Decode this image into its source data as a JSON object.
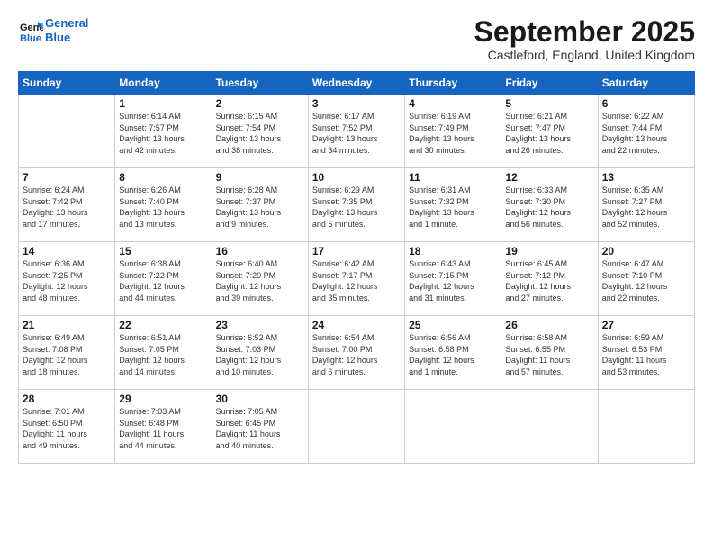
{
  "header": {
    "logo_line1": "General",
    "logo_line2": "Blue",
    "month": "September 2025",
    "location": "Castleford, England, United Kingdom"
  },
  "days_of_week": [
    "Sunday",
    "Monday",
    "Tuesday",
    "Wednesday",
    "Thursday",
    "Friday",
    "Saturday"
  ],
  "weeks": [
    [
      {
        "day": "",
        "info": ""
      },
      {
        "day": "1",
        "info": "Sunrise: 6:14 AM\nSunset: 7:57 PM\nDaylight: 13 hours\nand 42 minutes."
      },
      {
        "day": "2",
        "info": "Sunrise: 6:15 AM\nSunset: 7:54 PM\nDaylight: 13 hours\nand 38 minutes."
      },
      {
        "day": "3",
        "info": "Sunrise: 6:17 AM\nSunset: 7:52 PM\nDaylight: 13 hours\nand 34 minutes."
      },
      {
        "day": "4",
        "info": "Sunrise: 6:19 AM\nSunset: 7:49 PM\nDaylight: 13 hours\nand 30 minutes."
      },
      {
        "day": "5",
        "info": "Sunrise: 6:21 AM\nSunset: 7:47 PM\nDaylight: 13 hours\nand 26 minutes."
      },
      {
        "day": "6",
        "info": "Sunrise: 6:22 AM\nSunset: 7:44 PM\nDaylight: 13 hours\nand 22 minutes."
      }
    ],
    [
      {
        "day": "7",
        "info": "Sunrise: 6:24 AM\nSunset: 7:42 PM\nDaylight: 13 hours\nand 17 minutes."
      },
      {
        "day": "8",
        "info": "Sunrise: 6:26 AM\nSunset: 7:40 PM\nDaylight: 13 hours\nand 13 minutes."
      },
      {
        "day": "9",
        "info": "Sunrise: 6:28 AM\nSunset: 7:37 PM\nDaylight: 13 hours\nand 9 minutes."
      },
      {
        "day": "10",
        "info": "Sunrise: 6:29 AM\nSunset: 7:35 PM\nDaylight: 13 hours\nand 5 minutes."
      },
      {
        "day": "11",
        "info": "Sunrise: 6:31 AM\nSunset: 7:32 PM\nDaylight: 13 hours\nand 1 minute."
      },
      {
        "day": "12",
        "info": "Sunrise: 6:33 AM\nSunset: 7:30 PM\nDaylight: 12 hours\nand 56 minutes."
      },
      {
        "day": "13",
        "info": "Sunrise: 6:35 AM\nSunset: 7:27 PM\nDaylight: 12 hours\nand 52 minutes."
      }
    ],
    [
      {
        "day": "14",
        "info": "Sunrise: 6:36 AM\nSunset: 7:25 PM\nDaylight: 12 hours\nand 48 minutes."
      },
      {
        "day": "15",
        "info": "Sunrise: 6:38 AM\nSunset: 7:22 PM\nDaylight: 12 hours\nand 44 minutes."
      },
      {
        "day": "16",
        "info": "Sunrise: 6:40 AM\nSunset: 7:20 PM\nDaylight: 12 hours\nand 39 minutes."
      },
      {
        "day": "17",
        "info": "Sunrise: 6:42 AM\nSunset: 7:17 PM\nDaylight: 12 hours\nand 35 minutes."
      },
      {
        "day": "18",
        "info": "Sunrise: 6:43 AM\nSunset: 7:15 PM\nDaylight: 12 hours\nand 31 minutes."
      },
      {
        "day": "19",
        "info": "Sunrise: 6:45 AM\nSunset: 7:12 PM\nDaylight: 12 hours\nand 27 minutes."
      },
      {
        "day": "20",
        "info": "Sunrise: 6:47 AM\nSunset: 7:10 PM\nDaylight: 12 hours\nand 22 minutes."
      }
    ],
    [
      {
        "day": "21",
        "info": "Sunrise: 6:49 AM\nSunset: 7:08 PM\nDaylight: 12 hours\nand 18 minutes."
      },
      {
        "day": "22",
        "info": "Sunrise: 6:51 AM\nSunset: 7:05 PM\nDaylight: 12 hours\nand 14 minutes."
      },
      {
        "day": "23",
        "info": "Sunrise: 6:52 AM\nSunset: 7:03 PM\nDaylight: 12 hours\nand 10 minutes."
      },
      {
        "day": "24",
        "info": "Sunrise: 6:54 AM\nSunset: 7:00 PM\nDaylight: 12 hours\nand 6 minutes."
      },
      {
        "day": "25",
        "info": "Sunrise: 6:56 AM\nSunset: 6:58 PM\nDaylight: 12 hours\nand 1 minute."
      },
      {
        "day": "26",
        "info": "Sunrise: 6:58 AM\nSunset: 6:55 PM\nDaylight: 11 hours\nand 57 minutes."
      },
      {
        "day": "27",
        "info": "Sunrise: 6:59 AM\nSunset: 6:53 PM\nDaylight: 11 hours\nand 53 minutes."
      }
    ],
    [
      {
        "day": "28",
        "info": "Sunrise: 7:01 AM\nSunset: 6:50 PM\nDaylight: 11 hours\nand 49 minutes."
      },
      {
        "day": "29",
        "info": "Sunrise: 7:03 AM\nSunset: 6:48 PM\nDaylight: 11 hours\nand 44 minutes."
      },
      {
        "day": "30",
        "info": "Sunrise: 7:05 AM\nSunset: 6:45 PM\nDaylight: 11 hours\nand 40 minutes."
      },
      {
        "day": "",
        "info": ""
      },
      {
        "day": "",
        "info": ""
      },
      {
        "day": "",
        "info": ""
      },
      {
        "day": "",
        "info": ""
      }
    ]
  ]
}
